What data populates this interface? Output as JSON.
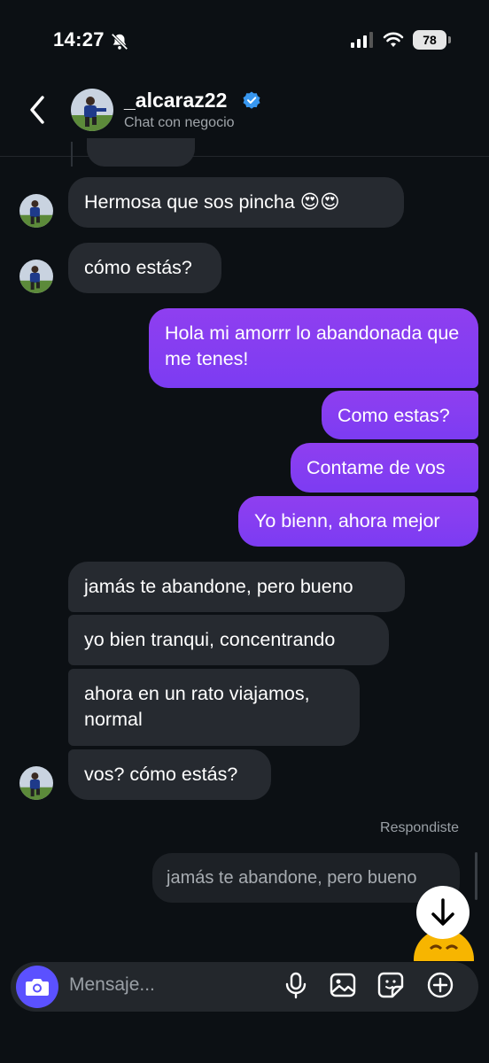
{
  "status_bar": {
    "time": "14:27",
    "battery": "78"
  },
  "header": {
    "username": "_alcaraz22",
    "subtitle": "Chat con negocio"
  },
  "messages": [
    {
      "from": "them",
      "text": "Hermosa que sos pincha 😍😍"
    },
    {
      "from": "them",
      "text": "cómo estás?"
    },
    {
      "from": "me",
      "text": "Hola mi amorrr lo abandonada que me tenes!"
    },
    {
      "from": "me",
      "text": "Como estas?"
    },
    {
      "from": "me",
      "text": "Contame de vos"
    },
    {
      "from": "me",
      "text": "Yo bienn, ahora mejor"
    },
    {
      "from": "them",
      "text": "jamás te abandone, pero bueno"
    },
    {
      "from": "them",
      "text": "yo bien tranqui, concentrando"
    },
    {
      "from": "them",
      "text": "ahora en un rato viajamos, normal"
    },
    {
      "from": "them",
      "text": "vos? cómo estás?"
    }
  ],
  "reply": {
    "label": "Respondiste",
    "quoted": "jamás te abandone, pero bueno"
  },
  "composer": {
    "placeholder": "Mensaje..."
  },
  "icons": {
    "camera": "camera-icon",
    "mic": "microphone-icon",
    "gallery": "image-icon",
    "sticker": "sticker-icon",
    "plus": "plus-icon",
    "scroll": "arrow-down-icon"
  },
  "colors": {
    "background": "#0c1014",
    "incoming": "#262a30",
    "outgoing": "#8a3ef0",
    "accent": "#5b51ff",
    "verified": "#3897f0"
  }
}
